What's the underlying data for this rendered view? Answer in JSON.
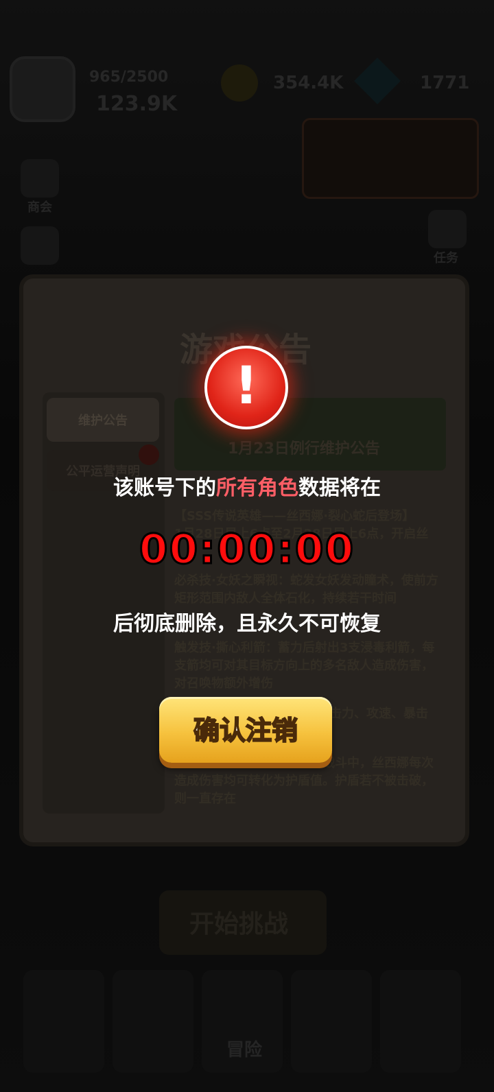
{
  "hud": {
    "hp": "965/2500",
    "power": "123.9K",
    "coins": "354.4K",
    "gems": "1771",
    "promo_text": "",
    "colors": {
      "accent": "#f6c23e",
      "danger": "#ff0d0d",
      "highlight": "#ff5e66"
    }
  },
  "side": {
    "left_top_label": "商会",
    "right_label": "任务"
  },
  "panel": {
    "title": "游戏公告",
    "tabs": [
      {
        "label": "维护公告"
      },
      {
        "label": "公平运营声明"
      }
    ],
    "banner_title": "1月23日例行维护公告",
    "article": [
      "【SSS传说英雄——丝西娜·裂心蛇后登场】",
      "1月28日早上6点至2月28日早上6点，开启丝",
      "必杀技·女妖之瞬视：蛇发女妖发动瞳术，使前方矩形范围内敌人全体石化，持续若干时间",
      "触发技·撕心利箭：蓄力后射出3支浸毒利箭，每支箭均可对其目标方向上的多名敌人造成伤害，对召唤物额外增伤",
      "击力、攻速、暴击",
      "为自身加持一个护盾。本场战斗中，丝西娜每次造成伤害均可转化为护盾值。护盾若不被击破，则一直存在"
    ]
  },
  "bottom": {
    "start_label": "开始挑战",
    "adventure_label": "冒险"
  },
  "modal": {
    "alert_glyph": "!",
    "line1_pre": "该账号下的",
    "line1_highlight": "所有角色",
    "line1_post": "数据将在",
    "countdown": "00:00:00",
    "line2": "后彻底删除，且永久不可恢复",
    "confirm_label": "确认注销"
  }
}
